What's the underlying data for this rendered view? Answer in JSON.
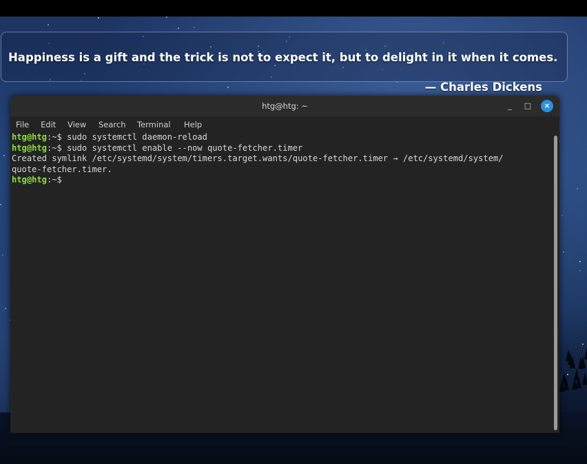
{
  "quote": {
    "text": "Happiness is a gift and the trick is not to expect it, but to delight in it when it comes.",
    "author": "— Charles Dickens"
  },
  "terminal": {
    "title": "htg@htg: ~",
    "window_buttons": {
      "minimize": "_",
      "maximize": "□",
      "close": "×"
    },
    "menu": [
      "File",
      "Edit",
      "View",
      "Search",
      "Terminal",
      "Help"
    ],
    "prompt_user": "htg@htg",
    "prompt_suffix": ":~$",
    "lines": [
      {
        "type": "command",
        "command": " sudo systemctl daemon-reload"
      },
      {
        "type": "command",
        "command": " sudo systemctl enable --now quote-fetcher.timer"
      },
      {
        "type": "output",
        "text": "Created symlink /etc/systemd/system/timers.target.wants/quote-fetcher.timer → /etc/systemd/system/"
      },
      {
        "type": "output",
        "text": "quote-fetcher.timer."
      },
      {
        "type": "command",
        "command": ""
      }
    ]
  },
  "colors": {
    "prompt_user": "#8ae234",
    "close_button": "#2a8fe0",
    "terminal_bg": "#232323"
  }
}
